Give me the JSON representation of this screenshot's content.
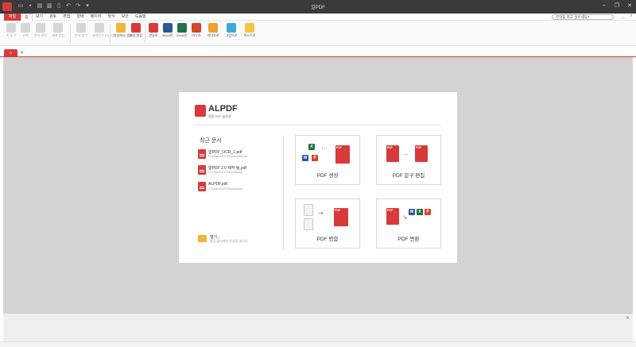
{
  "window": {
    "title": "알PDF"
  },
  "menu": {
    "items": [
      "파일",
      "홈",
      "보기",
      "검토",
      "편집",
      "형태",
      "페이지",
      "양식",
      "보안",
      "도움말"
    ],
    "search_placeholder": "무엇을 하고 싶으세요?"
  },
  "ribbon": {
    "buttons": [
      {
        "label": "손 도구"
      },
      {
        "label": "선택"
      },
      {
        "label": "문자 음림"
      },
      {
        "label": "개체 음림"
      },
      {
        "label": "문자 추가"
      },
      {
        "label": "글자인식 (OCR)"
      },
      {
        "label": "파일에서 생성"
      },
      {
        "label": "파일 병합"
      },
      {
        "label": "한글로"
      },
      {
        "label": "Word로"
      },
      {
        "label": "Excel로"
      },
      {
        "label": "PPT로"
      },
      {
        "label": "이미지로"
      },
      {
        "label": "그림으로"
      },
      {
        "label": "텍스트로"
      },
      {
        "label": "다른 파일로"
      }
    ]
  },
  "tabs": {
    "home_icon": "home-icon",
    "add_icon": "plus-icon"
  },
  "start": {
    "brand": "ALPDF",
    "brand_sub": "종합 PDF 솔루션",
    "recent_title": "최근 문서",
    "recent": [
      {
        "name": "알PDF_OCR_1.pdf",
        "path": "C:\\Users\\ESTN\\Documents"
      },
      {
        "name": "알PDF 2.0 제작 팀.pdf",
        "path": "C:\\Users\\ESTN\\Desktop"
      },
      {
        "name": "ALPDF.pdf",
        "path": "C:\\Users\\ESTN\\Desktop"
      }
    ],
    "open_label": "열기...",
    "open_sub": "최근 폴더에서 파일을 엽니다",
    "cards": [
      {
        "label": "PDF 생성"
      },
      {
        "label": "PDF 문구 편집"
      },
      {
        "label": "PDF 병합"
      },
      {
        "label": "PDF 변환"
      }
    ]
  },
  "colors": {
    "accent": "#d83a3a",
    "titlebar": "#3a3a3a",
    "workspace": "#d3d3d3"
  }
}
